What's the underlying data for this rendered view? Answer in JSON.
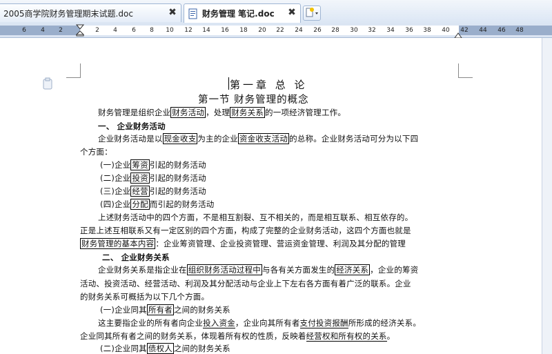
{
  "tabs": [
    {
      "label": "2005商学院财务管理期末试题.doc",
      "close": "✖"
    },
    {
      "label": "财务管理   笔记.doc",
      "close": "✖"
    }
  ],
  "ruler_ticks": [
    "6",
    "4",
    "2",
    "2",
    "4",
    "6",
    "8",
    "10",
    "12",
    "14",
    "16",
    "18",
    "20",
    "22",
    "24",
    "26",
    "28",
    "30",
    "32",
    "34",
    "36",
    "38",
    "40",
    "42",
    "44",
    "46",
    "48"
  ],
  "document": {
    "chapter_title": "第一章  总  论",
    "section_title": "第一节  财务管理的概念",
    "p1": {
      "a": "财务管理是组织企业",
      "b": "财务活动",
      "c": "，处理",
      "d": "财务关系",
      "e": "的一项经济管理工作。"
    },
    "h1": "一、 企业财务活动",
    "p2": {
      "a": "企业财务活动是以",
      "b": "现金收支",
      "c": "为主的企业",
      "d": "资金收支活动",
      "e": "的总称。企业财务活动可分为以下四"
    },
    "p2b": "个方面：",
    "list1": [
      {
        "pre": "(一)企业",
        "box": "筹资",
        "post": "引起的财务活动"
      },
      {
        "pre": "(二)企业",
        "box": "投资",
        "post": "引起的财务活动"
      },
      {
        "pre": "(三)企业",
        "box": "经营",
        "post": "引起的财务活动"
      },
      {
        "pre": "(四)企业",
        "box": "分配",
        "post": "而引起的财务活动"
      }
    ],
    "p3": "上述财务活动中的四个方面，不是相互割裂、互不相关的，而是相互联系、相互依存的。",
    "p3b": "正是上述互相联系又有一定区别的四个方面，构成了完整的企业财务活动，这四个方面也就是",
    "p3c": {
      "box": "财务管理的基本内容",
      "rest": "：企业筹资管理、企业投资管理、营运资金管理、利润及其分配的管理"
    },
    "h2": "二、 企业财务关系",
    "p4": {
      "a": "企业财务关系是指企业在",
      "b": "组织财务活动过程中",
      "c": "与各有关方面发生的",
      "d": "经济关系",
      "e": "，企业的筹资"
    },
    "p4b": "活动、投资活动、经营活动、利润及其分配活动与企业上下左右各方面有着广泛的联系。企业",
    "p4c": "的财务关系可概括为以下几个方面。",
    "list2a": {
      "pre": "(一)企业同其",
      "box": "所有者",
      "post": "之间的财务关系"
    },
    "p5": {
      "a": "这主要指企业的所有者向企业",
      "b": "投入资金",
      "c": "，企业向其所有者",
      "d": "支付投资报酬",
      "e": "所形成的经济关系。"
    },
    "p5b": {
      "a": "企业同其所有者之间的财务关系，体现着所有权的性质，反映着",
      "b": "经营权和所有权的关系",
      "c": "。"
    },
    "list2b": {
      "pre": "(二)企业同其",
      "box": "债权人",
      "post": "之间的财务关系"
    }
  }
}
